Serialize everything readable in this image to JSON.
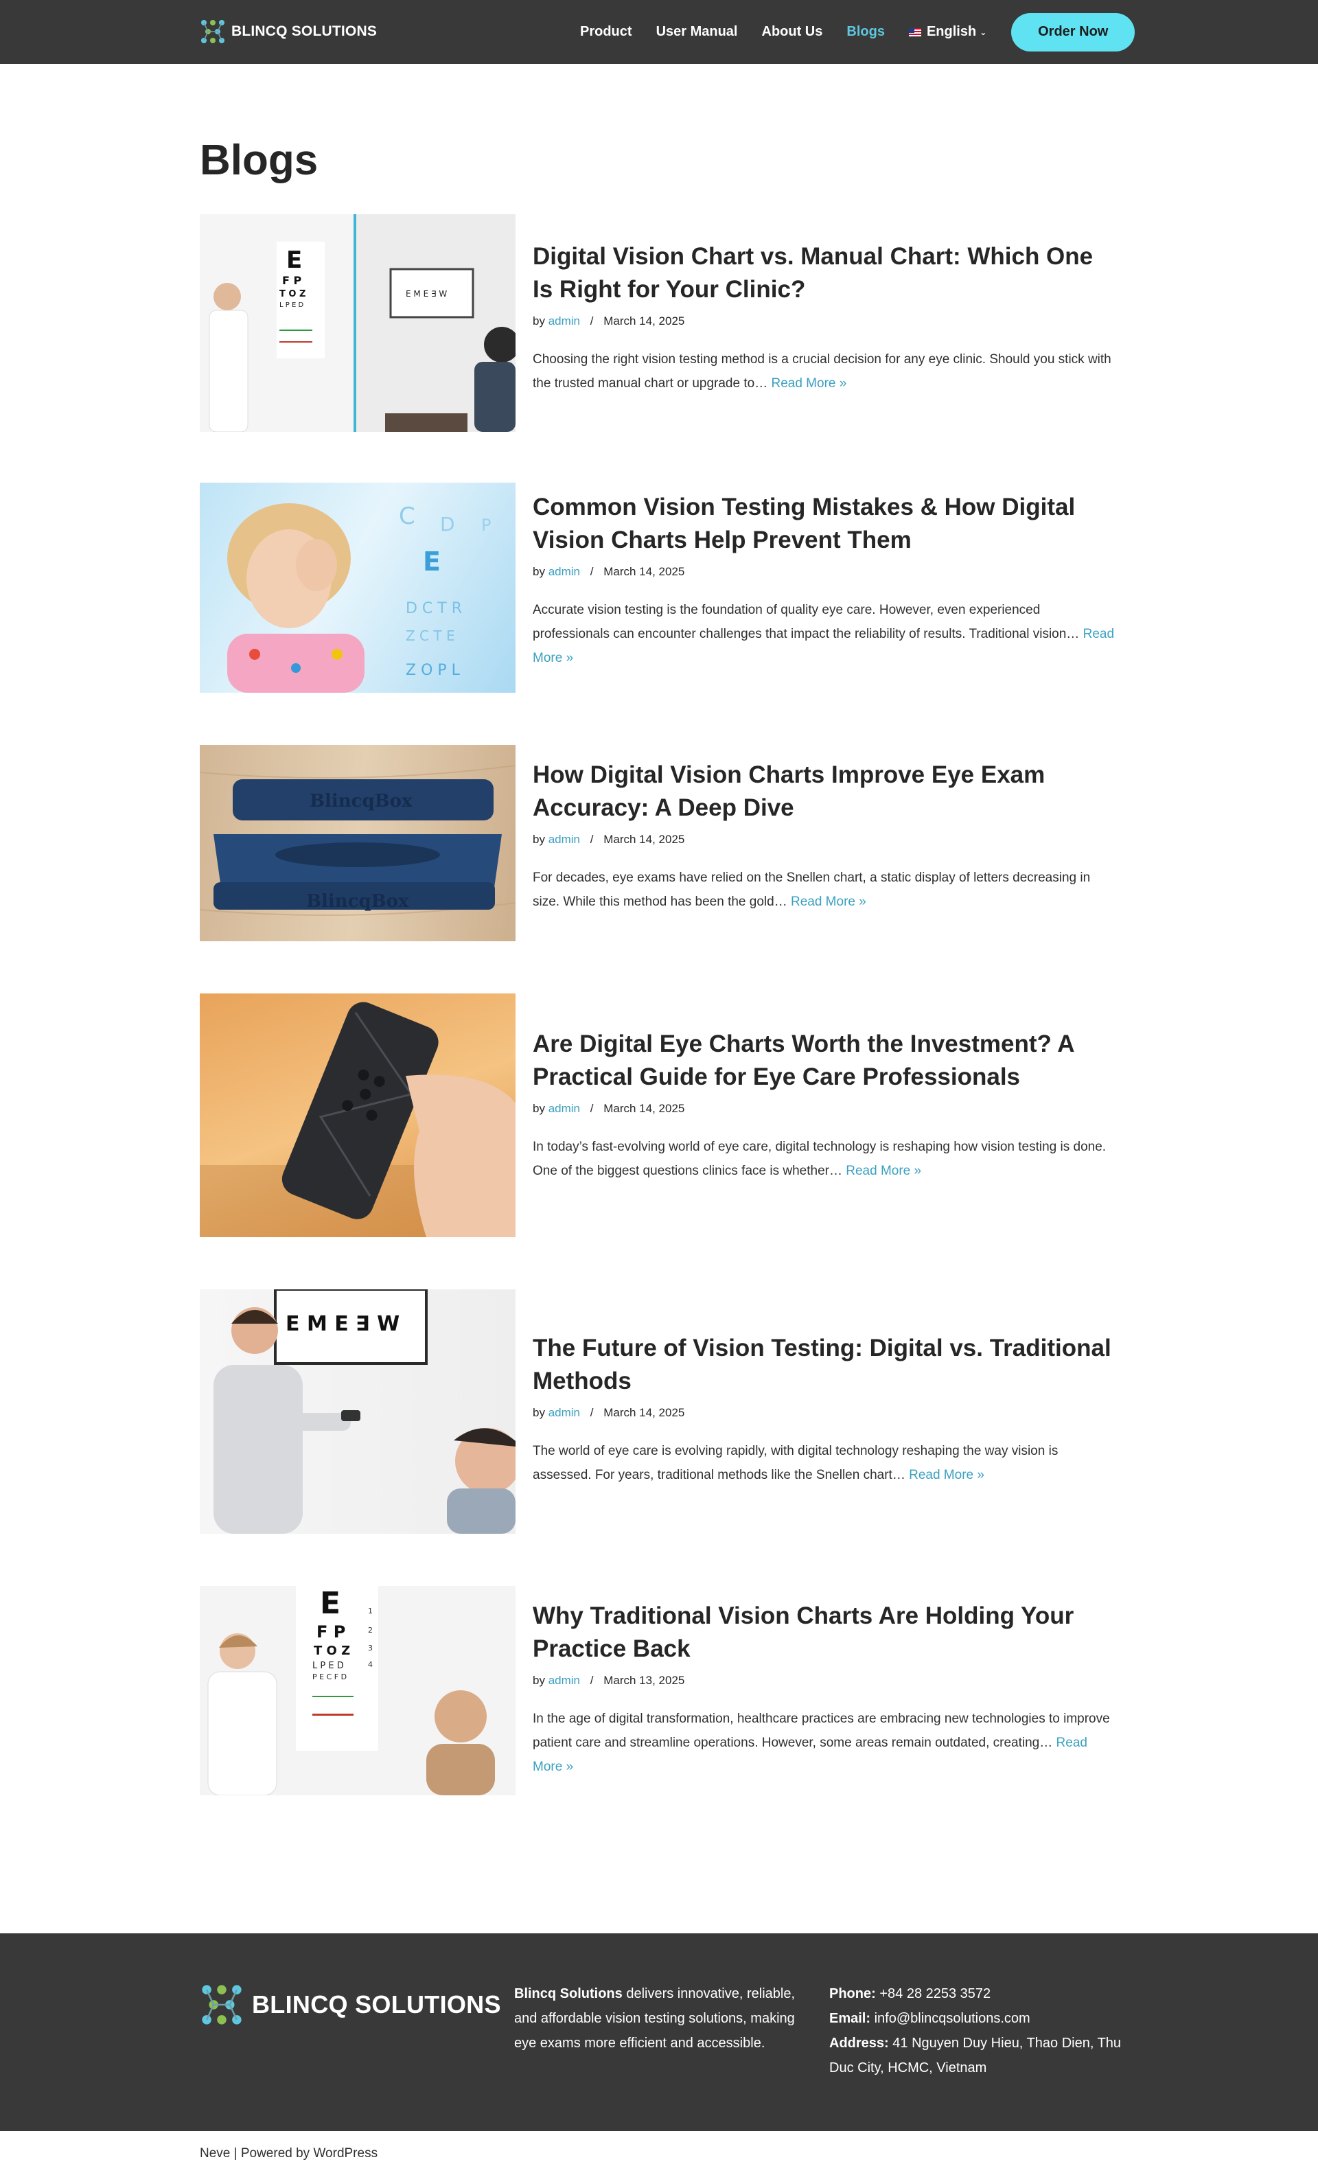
{
  "header": {
    "logo_text": "BLINCQ SOLUTIONS",
    "nav": [
      {
        "label": "Product"
      },
      {
        "label": "User Manual"
      },
      {
        "label": "About Us"
      },
      {
        "label": "Blogs",
        "active": true
      }
    ],
    "language": "English",
    "order_button": "Order Now"
  },
  "main": {
    "title": "Blogs",
    "read_more": "Read More »",
    "by": "by",
    "posts": [
      {
        "title": "Digital Vision Chart vs. Manual Chart: Which One Is Right for Your Clinic?",
        "author": "admin",
        "date": "March 14, 2025",
        "excerpt": "Choosing the right vision testing method is a crucial decision for any eye clinic. Should you stick with the trusted manual chart or upgrade to… "
      },
      {
        "title": "Common Vision Testing Mistakes & How Digital Vision Charts Help Prevent Them",
        "author": "admin",
        "date": "March 14, 2025",
        "excerpt": "Accurate vision testing is the foundation of quality eye care. However, even experienced professionals can encounter challenges that impact the reliability of results. Traditional vision… "
      },
      {
        "title": "How Digital Vision Charts Improve Eye Exam Accuracy: A Deep Dive",
        "author": "admin",
        "date": "March 14, 2025",
        "excerpt": "For decades, eye exams have relied on the Snellen chart, a static display of letters decreasing in size. While this method has been the gold… ",
        "image_text": "BlincqBox"
      },
      {
        "title": "Are Digital Eye Charts Worth the Investment? A Practical Guide for Eye Care Professionals",
        "author": "admin",
        "date": "March 14, 2025",
        "excerpt": "In today’s fast-evolving world of eye care, digital technology is reshaping how vision testing is done. One of the biggest questions clinics face is whether… "
      },
      {
        "title": "The Future of Vision Testing: Digital vs. Traditional Methods",
        "author": "admin",
        "date": "March 14, 2025",
        "excerpt": "The world of eye care is evolving rapidly, with digital technology reshaping the way vision is assessed. For years, traditional methods like the Snellen chart… "
      },
      {
        "title": "Why Traditional Vision Charts Are Holding Your Practice Back",
        "author": "admin",
        "date": "March 13, 2025",
        "excerpt": "In the age of digital transformation, healthcare practices are embracing new technologies to improve patient care and streamline operations. However, some areas remain outdated, creating… "
      }
    ]
  },
  "footer": {
    "logo_text": "BLINCQ SOLUTIONS",
    "about_bold": "Blincq Solutions",
    "about_rest": " delivers innovative, reliable, and affordable vision testing solutions, making eye exams more efficient and accessible.",
    "phone_label": "Phone:",
    "phone": " +84 28 2253 3572",
    "email_label": "Email:",
    "email": " info@blincqsolutions.com",
    "address_label": "Address:",
    "address": " 41 Nguyen Duy Hieu, Thao Dien, Thu Duc City, HCMC, Vietnam",
    "powered": "Neve | Powered by WordPress"
  },
  "colors": {
    "header_bg": "#393939",
    "accent": "#3aa0c0",
    "active_nav": "#5ec8e0",
    "order_button": "#5fe3f2"
  }
}
